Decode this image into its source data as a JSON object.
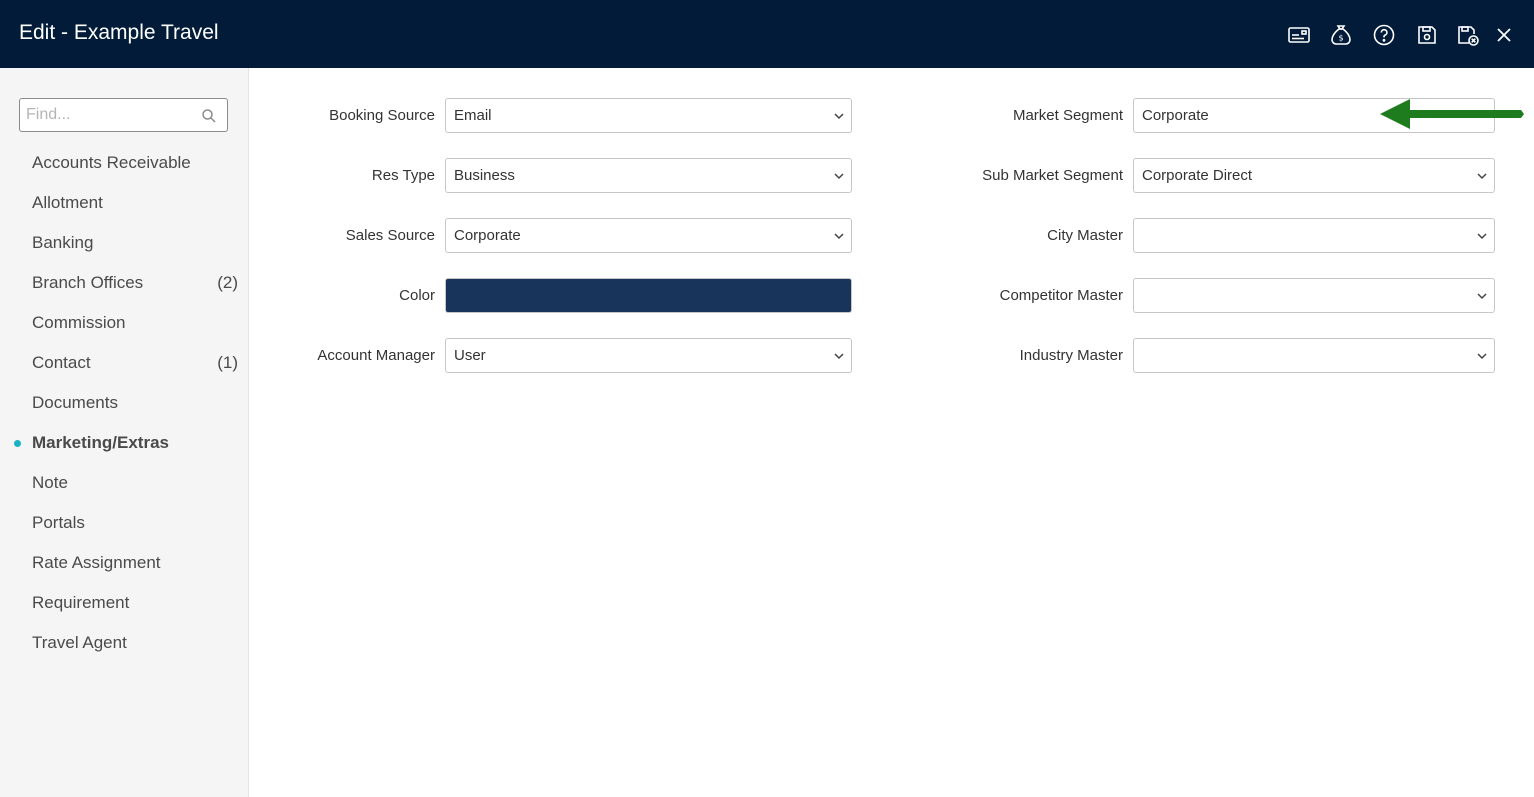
{
  "window": {
    "title": "Edit - Example Travel",
    "icons": [
      "card-icon",
      "money-bag-icon",
      "help-icon",
      "save-icon",
      "save-close-icon",
      "close-icon"
    ]
  },
  "sidebar": {
    "find_placeholder": "Find...",
    "items": [
      {
        "label": "Accounts Receivable",
        "count": ""
      },
      {
        "label": "Allotment",
        "count": ""
      },
      {
        "label": "Banking",
        "count": ""
      },
      {
        "label": "Branch Offices",
        "count": "(2)"
      },
      {
        "label": "Commission",
        "count": ""
      },
      {
        "label": "Contact",
        "count": "(1)"
      },
      {
        "label": "Documents",
        "count": ""
      },
      {
        "label": "Marketing/Extras",
        "count": "",
        "active": true
      },
      {
        "label": "Note",
        "count": ""
      },
      {
        "label": "Portals",
        "count": ""
      },
      {
        "label": "Rate Assignment",
        "count": ""
      },
      {
        "label": "Requirement",
        "count": ""
      },
      {
        "label": "Travel Agent",
        "count": ""
      }
    ],
    "active_dot_color": "#18b2c4"
  },
  "form": {
    "booking_source": {
      "label": "Booking Source",
      "value": "Email"
    },
    "res_type": {
      "label": "Res Type",
      "value": "Business"
    },
    "sales_source": {
      "label": "Sales Source",
      "value": "Corporate"
    },
    "color": {
      "label": "Color",
      "value": "#18345b"
    },
    "account_manager": {
      "label": "Account Manager",
      "value": "User"
    },
    "market_segment": {
      "label": "Market Segment",
      "value": "Corporate"
    },
    "sub_market_segment": {
      "label": "Sub Market Segment",
      "value": "Corporate Direct"
    },
    "city_master": {
      "label": "City Master",
      "value": ""
    },
    "competitor_master": {
      "label": "Competitor Master",
      "value": ""
    },
    "industry_master": {
      "label": "Industry Master",
      "value": ""
    }
  },
  "annotation": {
    "arrow_color": "#1e7b1e"
  }
}
